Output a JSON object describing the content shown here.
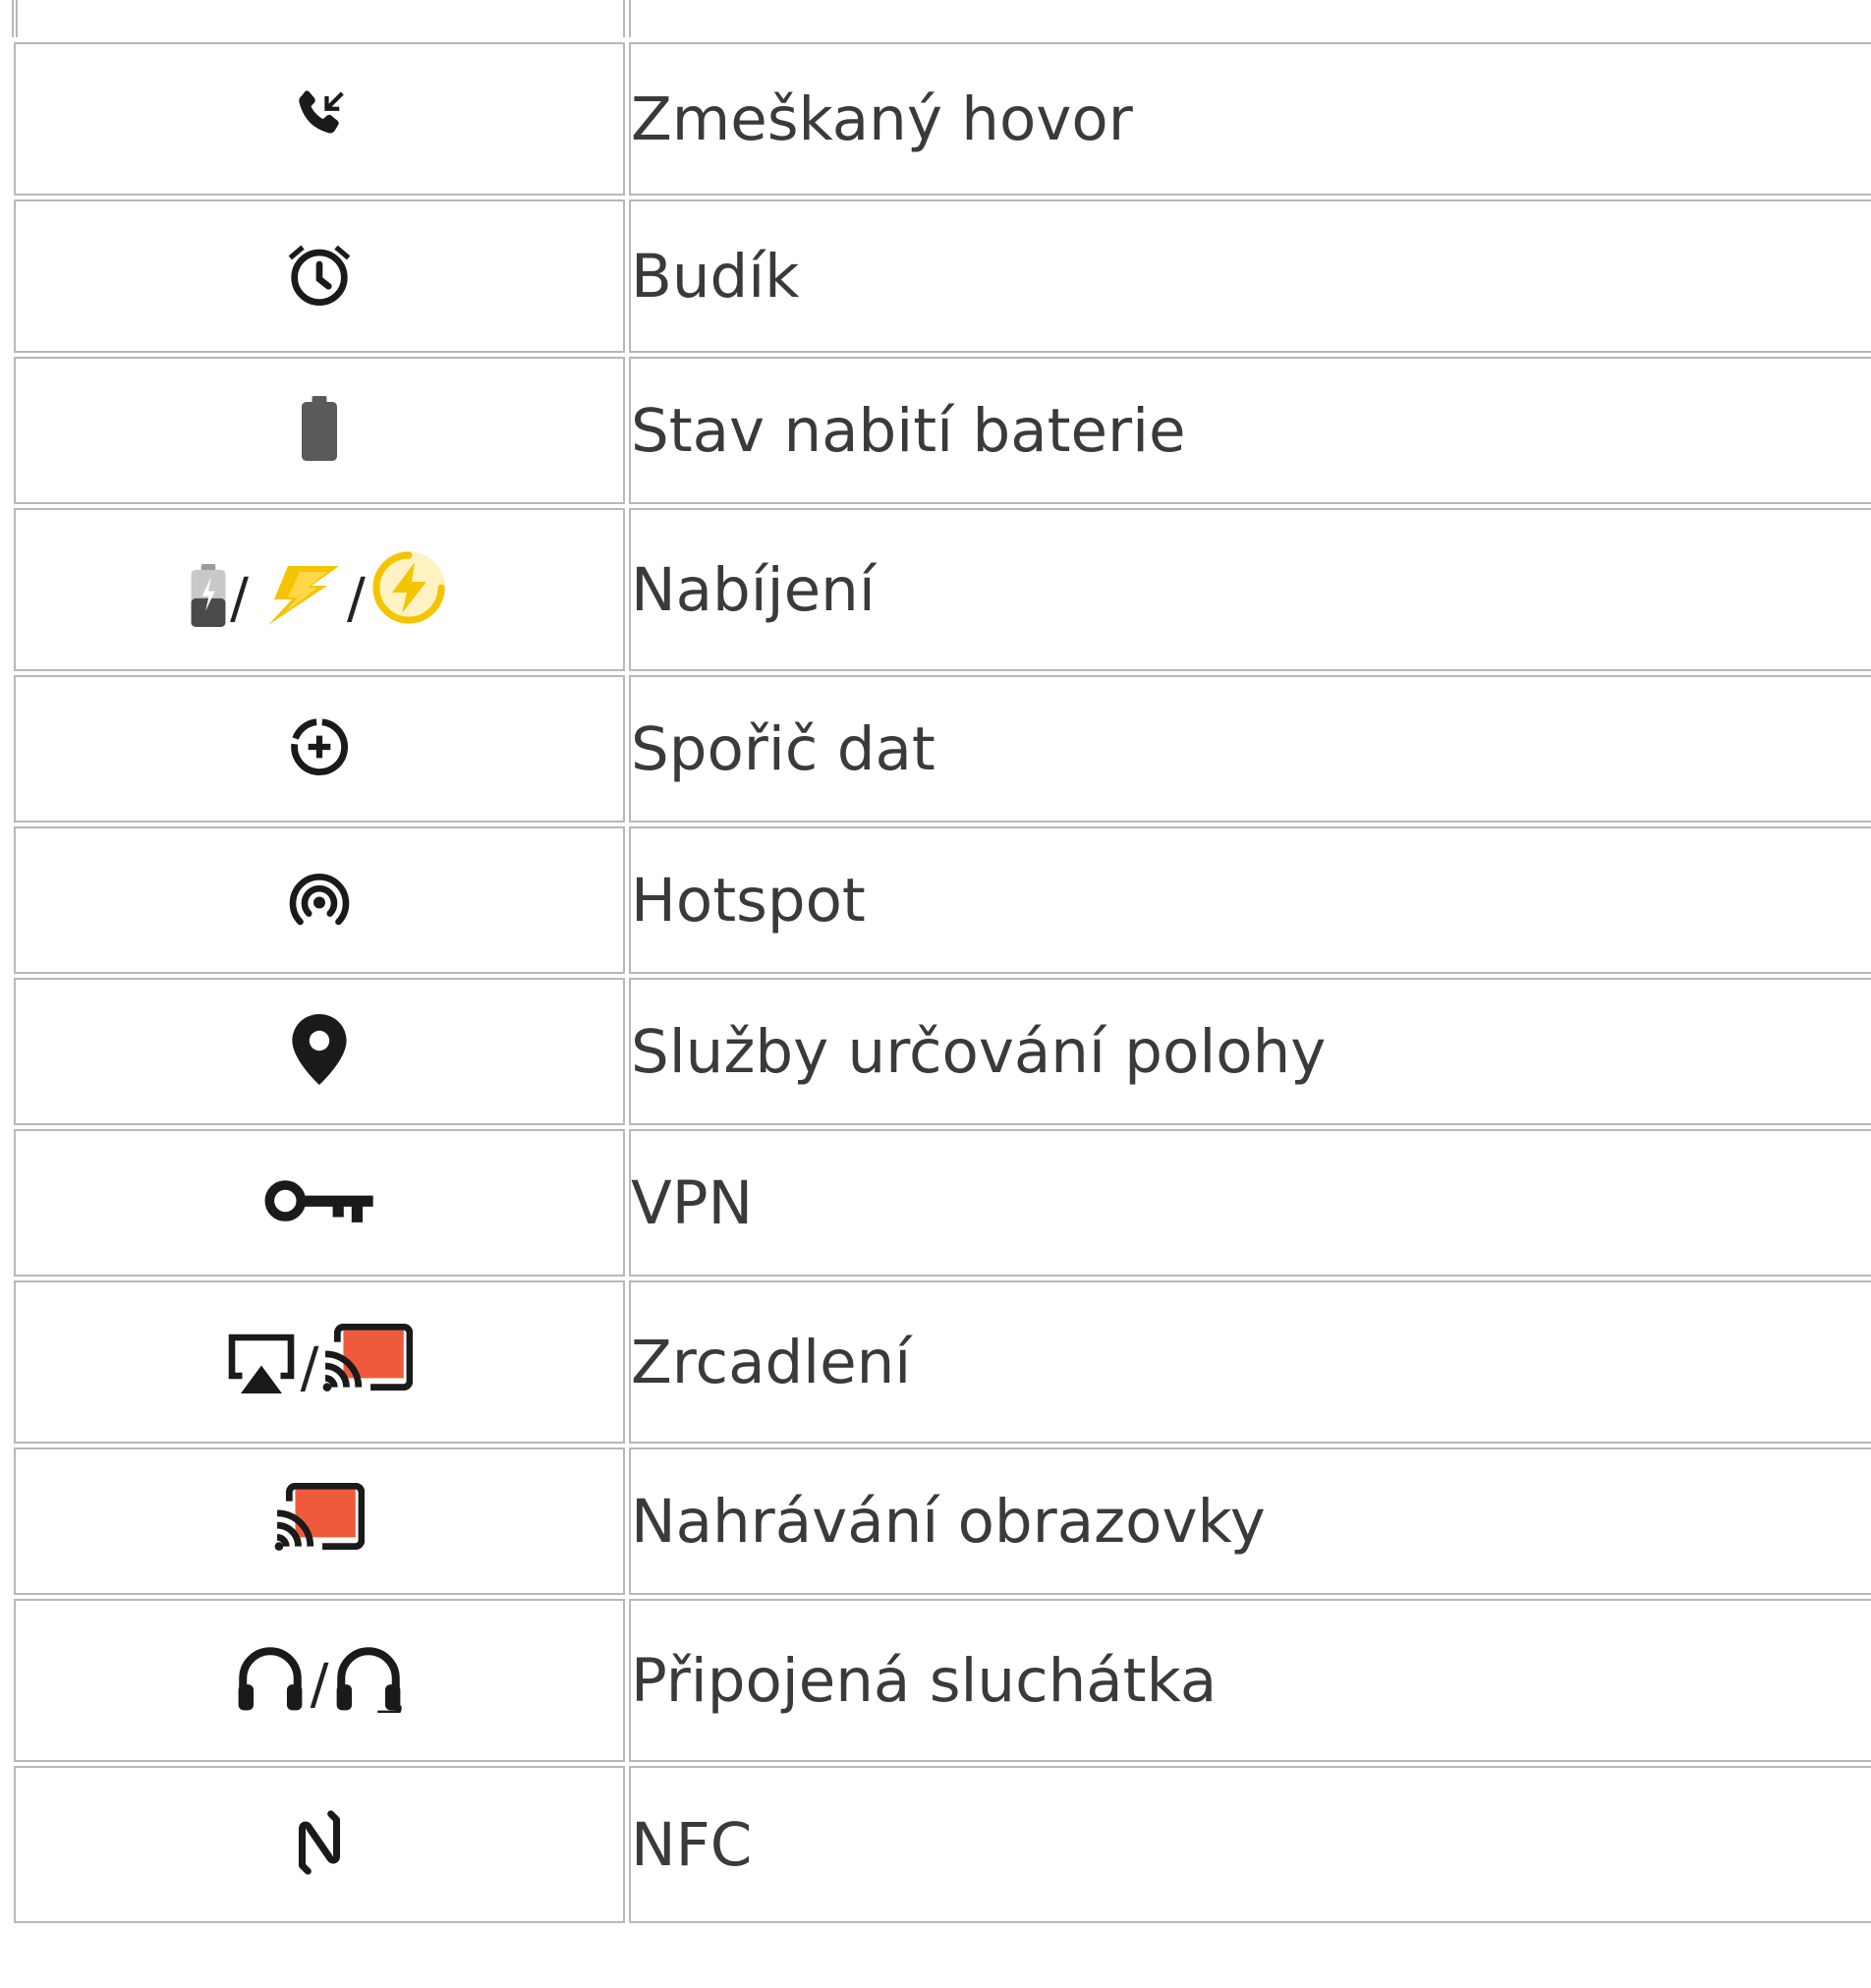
{
  "rows": [
    {
      "label": "Zmeškaný hovor",
      "icons": [
        "missed-call-icon"
      ]
    },
    {
      "label": "Budík",
      "icons": [
        "alarm-clock-icon"
      ]
    },
    {
      "label": "Stav nabití baterie",
      "icons": [
        "battery-icon"
      ]
    },
    {
      "label": "Nabíjení",
      "icons": [
        "battery-charging-icon",
        "lightning-icon",
        "fast-charging-icon"
      ],
      "separator": "/"
    },
    {
      "label": "Spořič dat",
      "icons": [
        "data-saver-icon"
      ]
    },
    {
      "label": "Hotspot",
      "icons": [
        "hotspot-icon"
      ]
    },
    {
      "label": "Služby určování polohy",
      "icons": [
        "location-pin-icon"
      ]
    },
    {
      "label": "VPN",
      "icons": [
        "vpn-key-icon"
      ]
    },
    {
      "label": "Zrcadlení",
      "icons": [
        "airplay-icon",
        "cast-icon"
      ],
      "separator": "/"
    },
    {
      "label": "Nahrávání obrazovky",
      "icons": [
        "cast-icon"
      ]
    },
    {
      "label": "Připojená sluchátka",
      "icons": [
        "headphones-icon",
        "headphones-alt-icon"
      ],
      "separator": "/"
    },
    {
      "label": "NFC",
      "icons": [
        "nfc-icon"
      ]
    }
  ],
  "colors": {
    "text": "#3a3a3a",
    "border": "#b8b8b8",
    "icon": "#1a1a1a",
    "charge_yellow": "#f5c400",
    "cast_orange": "#f05a3c"
  }
}
